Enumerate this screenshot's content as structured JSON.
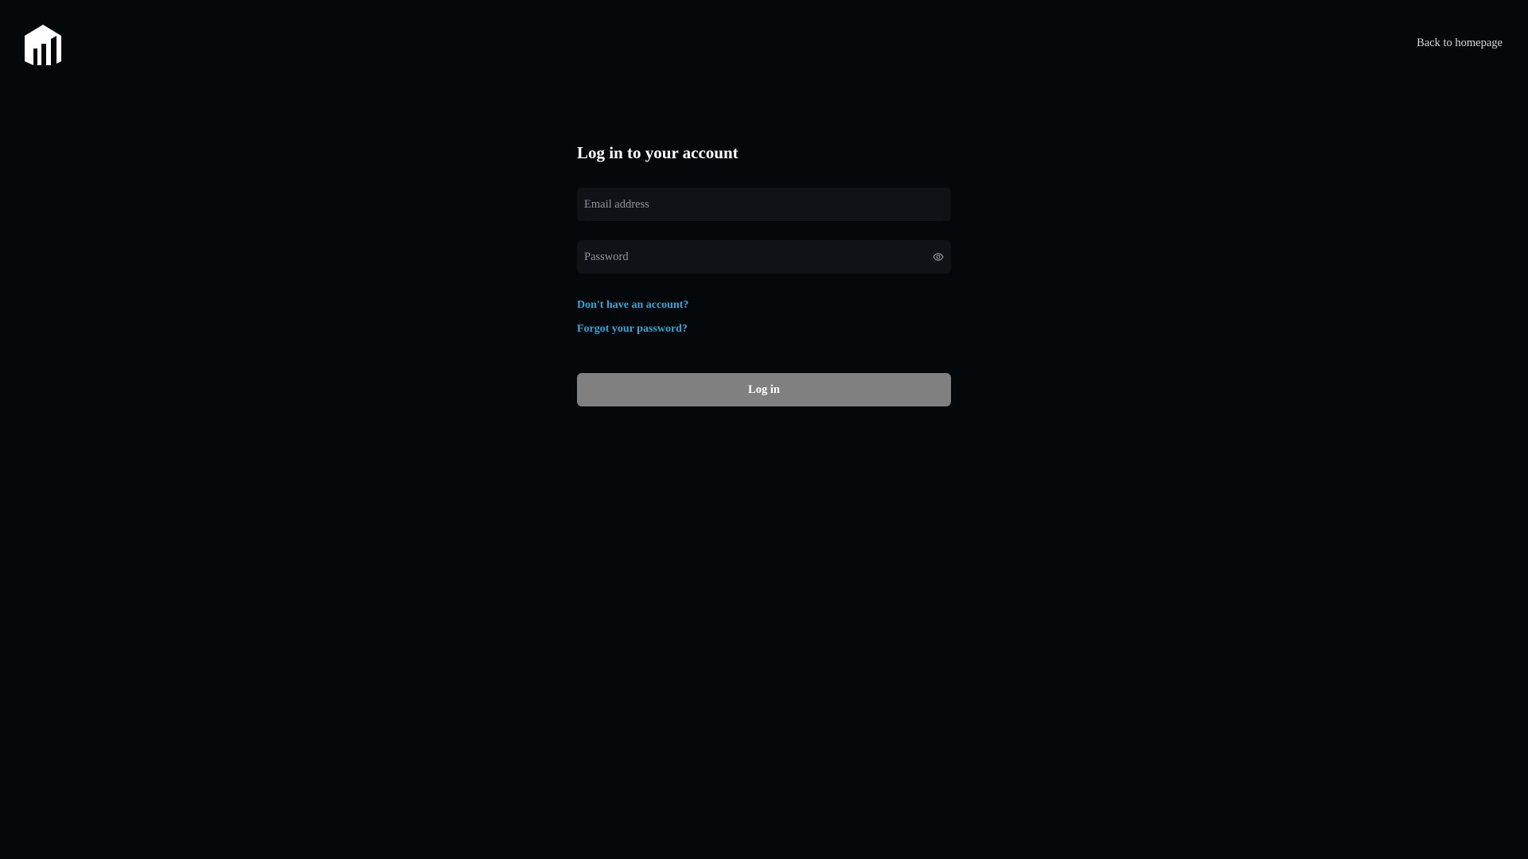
{
  "header": {
    "back_link_label": "Back to homepage"
  },
  "login": {
    "title": "Log in to your account",
    "email_placeholder": "Email address",
    "email_value": "",
    "password_placeholder": "Password",
    "password_value": "",
    "signup_link_label": "Don't have an account?",
    "forgot_link_label": "Forgot your password?",
    "submit_label": "Log in"
  },
  "icons": {
    "logo": "building-logo-icon",
    "password_toggle": "eye-icon"
  },
  "colors": {
    "background": "#05080b",
    "field_background": "#0f1317",
    "link": "#2ea8d8",
    "button_disabled": "#808080",
    "title": "#ffffff"
  }
}
